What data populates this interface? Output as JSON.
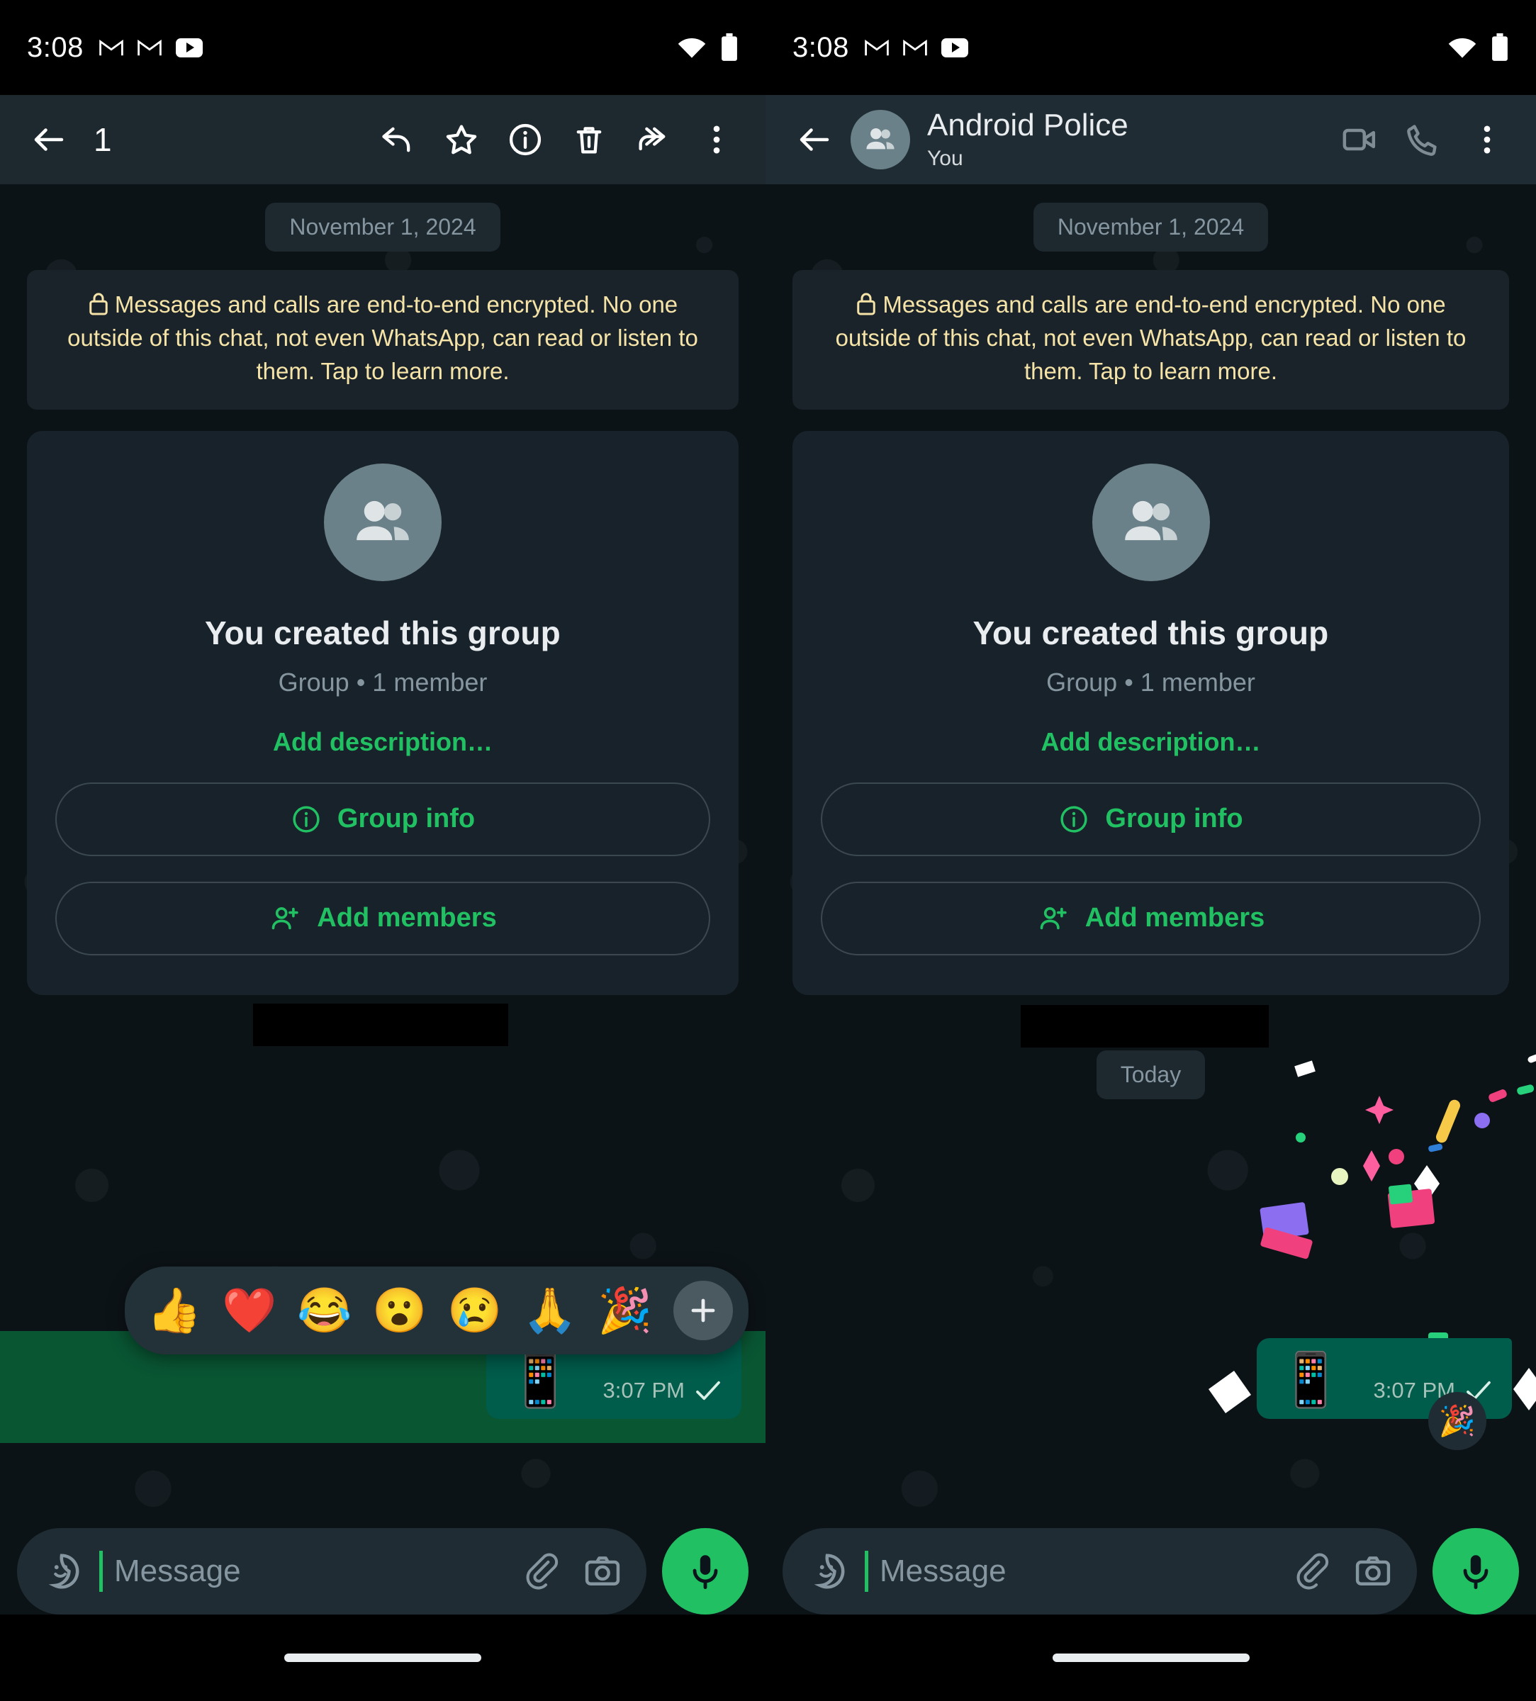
{
  "status_bar": {
    "time": "3:08",
    "left_icons": [
      "gmail-icon",
      "gmail-icon",
      "youtube-icon"
    ],
    "right_icons": [
      "wifi-icon",
      "battery-icon"
    ]
  },
  "left_screen": {
    "selection_toolbar": {
      "back_label": "back-icon",
      "selected_count": "1",
      "actions": [
        {
          "name": "reply-icon",
          "label": "Reply"
        },
        {
          "name": "star-icon",
          "label": "Star"
        },
        {
          "name": "info-icon",
          "label": "Info"
        },
        {
          "name": "delete-icon",
          "label": "Delete"
        },
        {
          "name": "forward-icon",
          "label": "Forward"
        },
        {
          "name": "overflow-menu-icon",
          "label": "More options"
        }
      ]
    },
    "reaction_picker": {
      "emojis": [
        "👍",
        "❤️",
        "😂",
        "😮",
        "😢",
        "🙏",
        "🎉"
      ],
      "more_label": "+"
    }
  },
  "right_screen": {
    "app_bar": {
      "title": "Android Police",
      "subtitle": "You",
      "actions": [
        {
          "name": "video-call-icon",
          "label": "Video call"
        },
        {
          "name": "voice-call-icon",
          "label": "Voice call"
        },
        {
          "name": "overflow-menu-icon",
          "label": "More options"
        }
      ]
    },
    "today_chip": "Today",
    "reaction_on_message": "🎉"
  },
  "chat": {
    "date_chip": "November 1, 2024",
    "encryption_notice": "Messages and calls are end-to-end encrypted. No one outside of this chat, not even WhatsApp, can read or listen to them. Tap to learn more.",
    "group_card": {
      "title": "You created this group",
      "subtitle": "Group • 1 member",
      "description_link": "Add description…",
      "group_info_button": "Group info",
      "add_members_button": "Add members"
    },
    "message": {
      "content_emoji": "📱",
      "time": "3:07 PM",
      "status": "sent-single-check"
    }
  },
  "input_bar": {
    "placeholder": "Message",
    "sticker_icon": "emoji-sticker-icon",
    "attach_icon": "paperclip-icon",
    "camera_icon": "camera-icon",
    "mic_icon": "microphone-icon"
  },
  "colors": {
    "accent_green": "#21c063",
    "bubble_green": "#005c4b",
    "selection_green": "#0a5c36",
    "encryption_yellow": "#f5e3a8",
    "app_bar": "#1f2c33",
    "wallpaper": "#0c1317"
  }
}
